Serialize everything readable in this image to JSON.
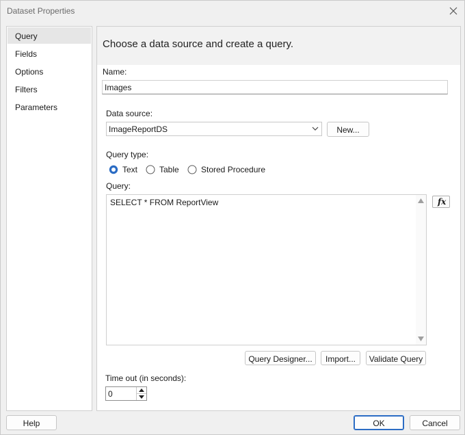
{
  "window": {
    "title": "Dataset Properties"
  },
  "nav": {
    "items": [
      {
        "label": "Query",
        "selected": true
      },
      {
        "label": "Fields"
      },
      {
        "label": "Options"
      },
      {
        "label": "Filters"
      },
      {
        "label": "Parameters"
      }
    ]
  },
  "header": {
    "text": "Choose a data source and create a query."
  },
  "name": {
    "label": "Name:",
    "value": "Images"
  },
  "data_source": {
    "label": "Data source:",
    "value": "ImageReportDS",
    "new_button": "New..."
  },
  "query_type": {
    "label": "Query type:",
    "options": [
      "Text",
      "Table",
      "Stored Procedure"
    ],
    "selected": "Text"
  },
  "query": {
    "label": "Query:",
    "value": "SELECT * FROM ReportView",
    "fx_button": "fx"
  },
  "buttons": {
    "query_designer": "Query Designer...",
    "import": "Import...",
    "validate": "Validate Query",
    "help": "Help",
    "ok": "OK",
    "cancel": "Cancel"
  },
  "timeout": {
    "label": "Time out (in seconds):",
    "value": "0"
  },
  "colors": {
    "accent": "#2b6cc4",
    "nav_selected": "#e6e6e6"
  }
}
